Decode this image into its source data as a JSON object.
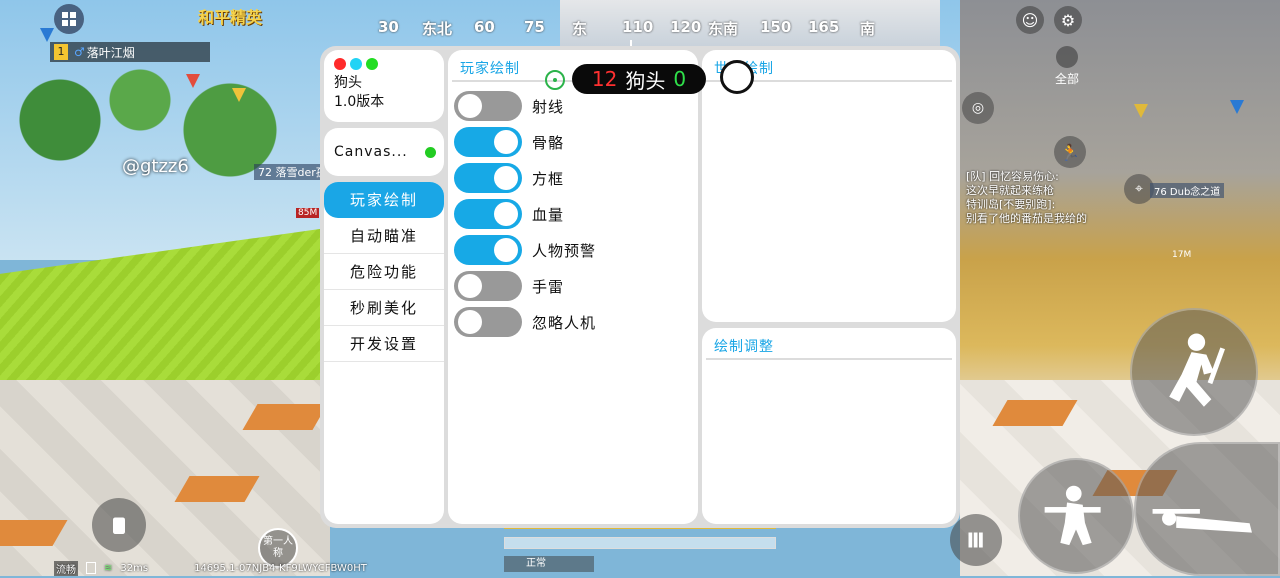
{
  "hud": {
    "game_title": "和平精英",
    "compass": [
      "30",
      "东北",
      "60",
      "75",
      "东",
      "110",
      "120",
      "东南",
      "150",
      "165",
      "南"
    ],
    "team_number": "1",
    "team_player": "落叶江烟",
    "player_tag": "@gtzz6",
    "enemy_left": "落雪der孤",
    "enemy_left_level": "72",
    "enemy_left_dist": "85M",
    "all_label": "全部",
    "chat_lines": [
      "[队] 回忆容易伤心:",
      "这次早就起来练枪",
      "特训岛[不要别跑]:",
      "别看了他的番茄是我给的"
    ],
    "enemy_right": "Dub念之道",
    "enemy_right_level": "76",
    "enemy_right_dist": "17M",
    "perspective": "第一人称",
    "status_label": "正常",
    "status": {
      "flow": "流畅",
      "ping": "32ms",
      "device_id": "14695.1-07NJB4-KF9LWYCFBW0HT"
    }
  },
  "menu": {
    "app_name": "狗头",
    "version": "1.0版本",
    "canvas_label": "Canvas...",
    "nav": [
      "玩家绘制",
      "自动瞄准",
      "危险功能",
      "秒刷美化",
      "开发设置"
    ],
    "active_nav": 0,
    "main_title": "玩家绘制",
    "toggles": [
      {
        "label": "射线",
        "on": false
      },
      {
        "label": "骨骼",
        "on": true
      },
      {
        "label": "方框",
        "on": true
      },
      {
        "label": "血量",
        "on": true
      },
      {
        "label": "人物预警",
        "on": true
      },
      {
        "label": "手雷",
        "on": false
      },
      {
        "label": "忽略人机",
        "on": false
      }
    ],
    "world_title": "世界绘制",
    "adjust_title": "绘制调整"
  },
  "counter": {
    "left": "12",
    "label": "狗头",
    "right": "0"
  },
  "colors": {
    "accent": "#1aa6e6",
    "switch_on": "#17a9e6",
    "switch_off": "#999999",
    "dot_red": "#ff2a2a",
    "dot_cyan": "#22d3f5",
    "dot_green": "#22dd22",
    "canvas_status": "#22cc22"
  }
}
